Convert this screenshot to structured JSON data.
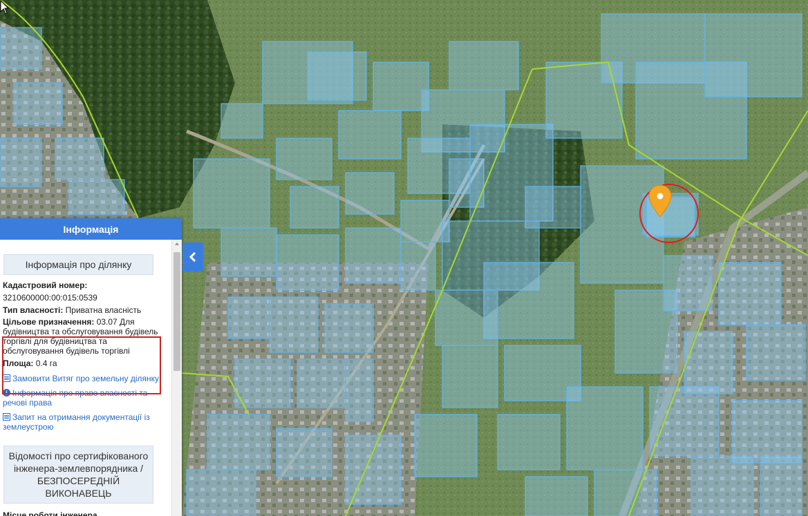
{
  "colors": {
    "accent": "#3b7ddd",
    "parcel_stroke": "#5fb4ee",
    "parcel_fill": "rgba(140,200,240,0.45)",
    "boundary_line": "#a8d832",
    "marker": "#f5a623",
    "highlight_circle": "#e01d1d"
  },
  "panel": {
    "header": "Інформація",
    "section_title": "Інформація про ділянку",
    "cadastral_label": "Кадастровий номер:",
    "cadastral_value": "3210600000:00:015:0539",
    "ownership_label": "Тип власності:",
    "ownership_value": "Приватна власність",
    "purpose_label": "Цільове призначення:",
    "purpose_value": "03.07 Для будівництва та обслуговування будівель торгівлі для будівництва та обслуговування будівель торгівлі",
    "area_label": "Площа:",
    "area_value": "0.4 га",
    "links": [
      {
        "icon": "list-icon",
        "text": "Замовити Витяг про земельну ділянку"
      },
      {
        "icon": "info-icon",
        "text": "Інформація про право власності та речові права"
      },
      {
        "icon": "list-icon",
        "text": "Запит на отримання документації із землеустрою"
      }
    ],
    "engineer_box": "Відомості про сертифікованого інженера-землевпорядника / БЕЗПОСЕРЕДНІЙ ВИКОНАВЕЦЬ",
    "work_place_label": "Місце роботи інженера"
  },
  "map": {
    "collapse_icon": "chevron-left-icon",
    "marker_icon": "location-pin-icon"
  }
}
